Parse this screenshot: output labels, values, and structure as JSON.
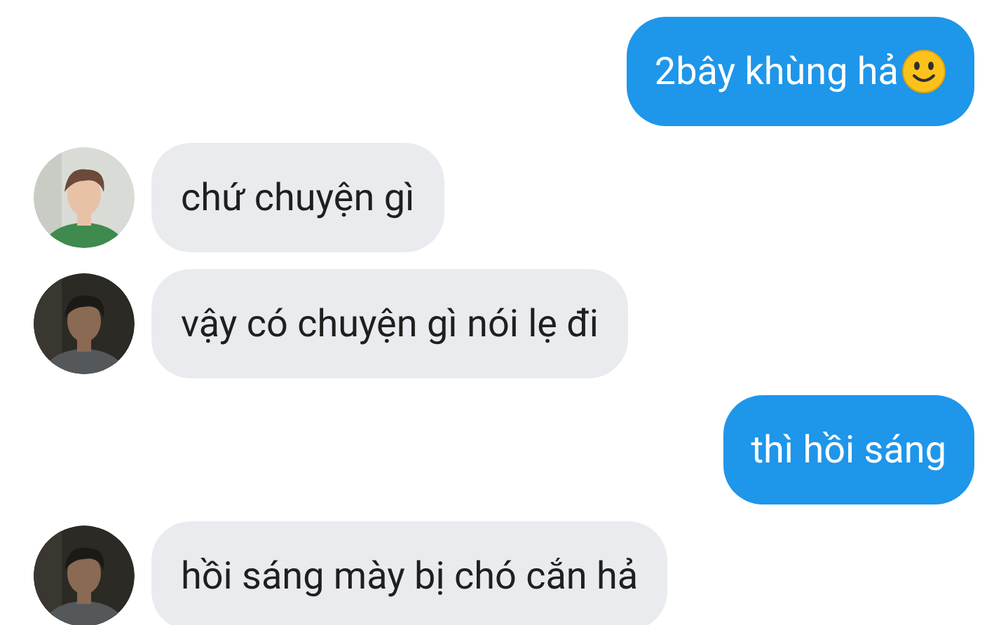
{
  "messages": [
    {
      "kind": "sent",
      "text": "2bây khùng hả",
      "smiley": true
    },
    {
      "kind": "received",
      "text": "chứ chuyện gì",
      "smiley": false
    },
    {
      "kind": "received",
      "text": "vậy có chuyện gì nói lẹ đi",
      "smiley": false
    },
    {
      "kind": "sent",
      "text": "thì hồi sáng",
      "smiley": false
    },
    {
      "kind": "received",
      "text": "hồi sáng mày bị chó cắn hả",
      "smiley": false
    }
  ]
}
